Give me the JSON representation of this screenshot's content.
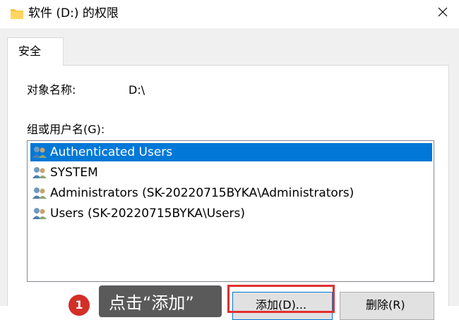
{
  "window": {
    "title": "软件 (D:) 的权限",
    "folder_icon": "folder-icon",
    "close_icon": "close-icon"
  },
  "tabs": [
    {
      "label": "安全"
    }
  ],
  "security": {
    "object_name_label": "对象名称:",
    "object_name_value": "D:\\",
    "group_label": "组或用户名(G):",
    "users": [
      {
        "name": "Authenticated Users",
        "icon": "user-group-icon",
        "selected": true
      },
      {
        "name": "SYSTEM",
        "icon": "user-group-icon",
        "selected": false
      },
      {
        "name": "Administrators (SK-20220715BYKA\\Administrators)",
        "icon": "user-group-icon",
        "selected": false
      },
      {
        "name": "Users (SK-20220715BYKA\\Users)",
        "icon": "user-group-icon",
        "selected": false
      }
    ],
    "add_label": "添加(D)...",
    "remove_label": "删除(R)"
  },
  "annotation": {
    "step_number": "1",
    "callout_text": "点击“添加”"
  },
  "colors": {
    "selection": "#0078d7",
    "highlight_box": "#e0302e",
    "badge": "#d22f27",
    "callout_bg": "#5a5a5a"
  }
}
